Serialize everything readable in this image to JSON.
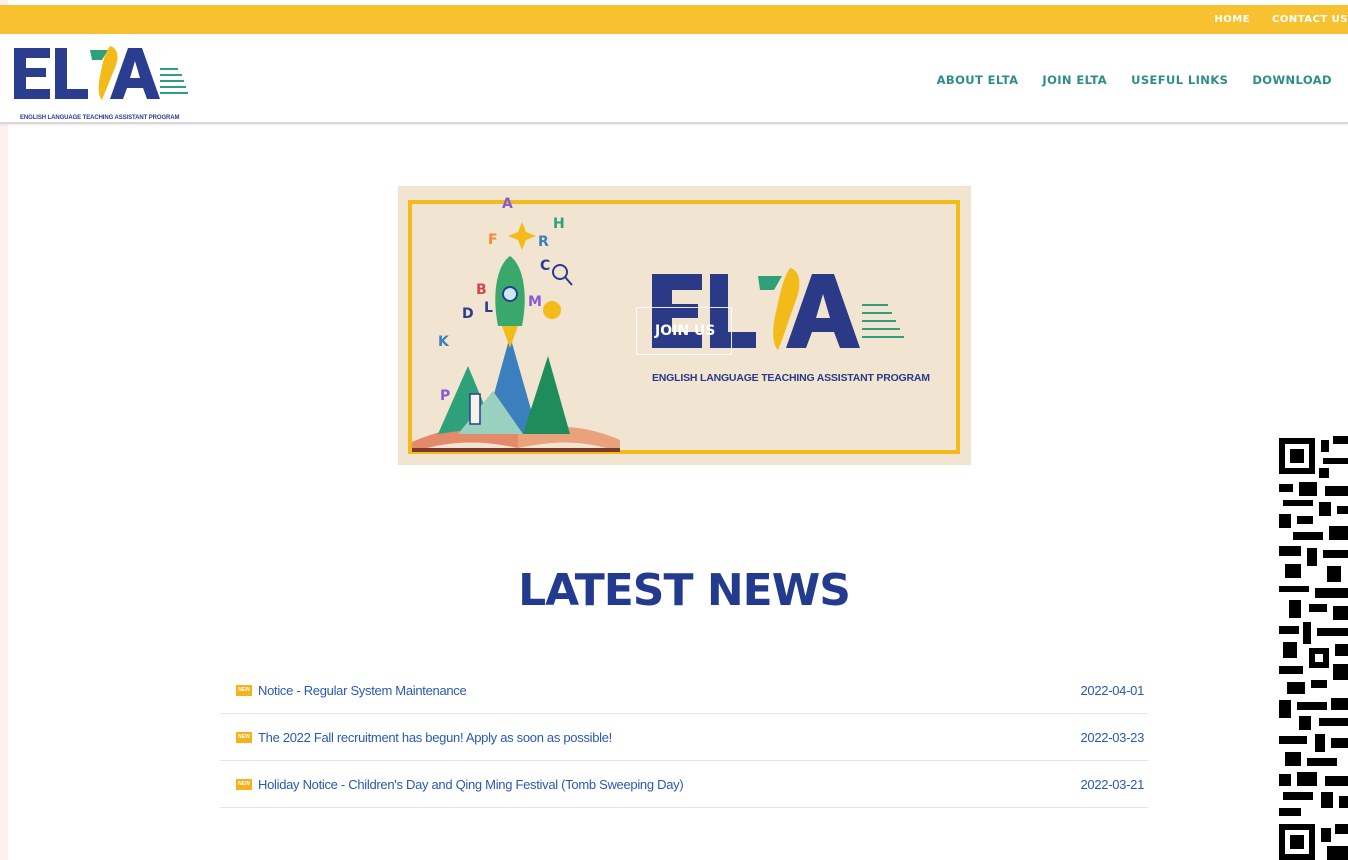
{
  "topbar": {
    "links": [
      {
        "label": "HOME"
      },
      {
        "label": "CONTACT US"
      }
    ]
  },
  "header": {
    "logo_text": "ELTA",
    "logo_subtitle": "ENGLISH LANGUAGE TEACHING ASSISTANT PROGRAM",
    "nav": [
      {
        "label": "ABOUT ELTA"
      },
      {
        "label": "JOIN ELTA"
      },
      {
        "label": "USEFUL LINKS"
      },
      {
        "label": "DOWNLOAD"
      }
    ]
  },
  "banner": {
    "button_label": "JOIN US",
    "logo_text": "ELTA",
    "caption": "ENGLISH LANGUAGE TEACHING ASSISTANT PROGRAM",
    "doodle_letters": [
      "A",
      "H",
      "F",
      "R",
      "C",
      "B",
      "D",
      "L",
      "M",
      "K",
      "P"
    ]
  },
  "news": {
    "title": "LATEST NEWS",
    "badge": "NEW",
    "items": [
      {
        "title": "Notice - Regular System Maintenance",
        "date": "2022-04-01"
      },
      {
        "title": "The 2022 Fall recruitment has begun! Apply as soon as possible!",
        "date": "2022-03-23"
      },
      {
        "title": "Holiday Notice - Children's Day and Qing Ming Festival (Tomb Sweeping Day)",
        "date": "2022-03-21"
      }
    ]
  },
  "colors": {
    "topbar": "#f8c12f",
    "nav": "#2e8d8a",
    "brand_blue": "#233b8e",
    "link": "#2b58b4",
    "banner_bg": "#f1e4d1",
    "banner_frame": "#f3bb19"
  }
}
